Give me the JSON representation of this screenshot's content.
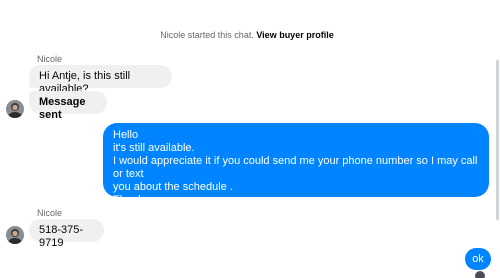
{
  "system_notice": {
    "text": "Nicole started this chat.",
    "link": "View buyer profile"
  },
  "messages": [
    {
      "sender": "Nicole",
      "text": "Hi Antje, is this still available?"
    },
    {
      "text": "Message sent"
    },
    {
      "lines": [
        "Hello",
        "it's still available.",
        "I would appreciate it if you could send me your phone number so I may call or text",
        "you about the schedule .",
        "Thank you"
      ]
    },
    {
      "sender": "Nicole",
      "text": "518-375-9719"
    },
    {
      "text": "ok"
    }
  ],
  "colors": {
    "outgoing": "#0084ff",
    "incoming": "#f0f0f0",
    "muted_text": "#65676b"
  }
}
